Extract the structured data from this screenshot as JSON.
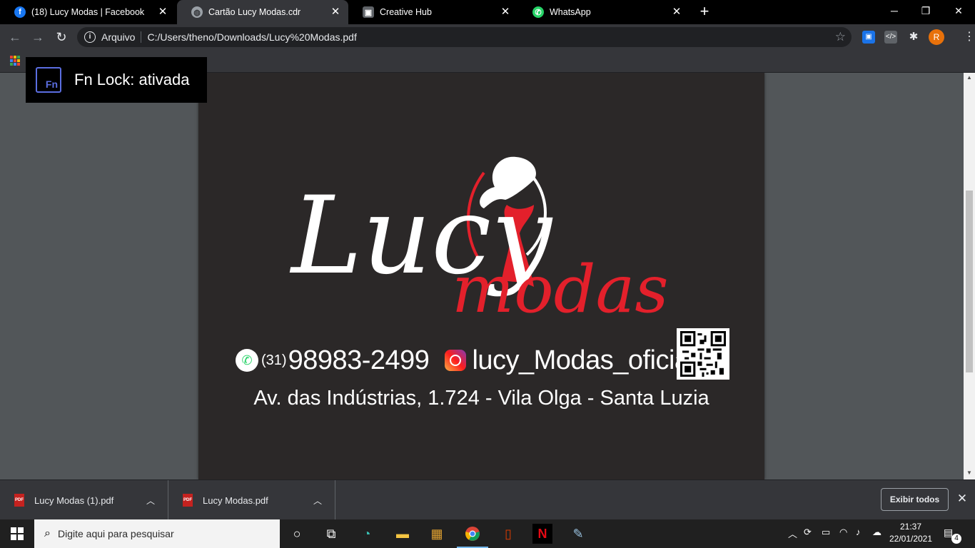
{
  "tabs": [
    {
      "label": "(18) Lucy Modas | Facebook",
      "icon": "facebook-icon",
      "color": "#1877f2"
    },
    {
      "label": "Cartão Lucy Modas.cdr",
      "icon": "globe-icon",
      "color": "#9aa0a6"
    },
    {
      "label": "Creative Hub",
      "icon": "creative-hub-icon",
      "color": "#5f6368"
    },
    {
      "label": "WhatsApp",
      "icon": "whatsapp-icon",
      "color": "#25d366"
    }
  ],
  "omnibox": {
    "scheme": "Arquivo",
    "url": "C:/Users/theno/Downloads/Lucy%20Modas.pdf"
  },
  "profile": {
    "initial": "R"
  },
  "osd": {
    "text": "Fn Lock: ativada",
    "icon_text": "Fn"
  },
  "card": {
    "logo_script": "Lucy",
    "logo_accent": "modas",
    "area_code": "(31)",
    "phone": "98983-2499",
    "instagram": "lucy_Modas_oficial",
    "address": "Av. das Indústrias, 1.724 - Vila Olga - Santa Luzia",
    "accent_color": "#e3202b",
    "background": "#2b2828"
  },
  "downloads": {
    "items": [
      {
        "name": "Lucy Modas (1).pdf"
      },
      {
        "name": "Lucy Modas.pdf"
      }
    ],
    "show_all": "Exibir todos"
  },
  "taskbar": {
    "search_placeholder": "Digite aqui para pesquisar",
    "time": "21:37",
    "date": "22/01/2021",
    "notifications": "4"
  }
}
